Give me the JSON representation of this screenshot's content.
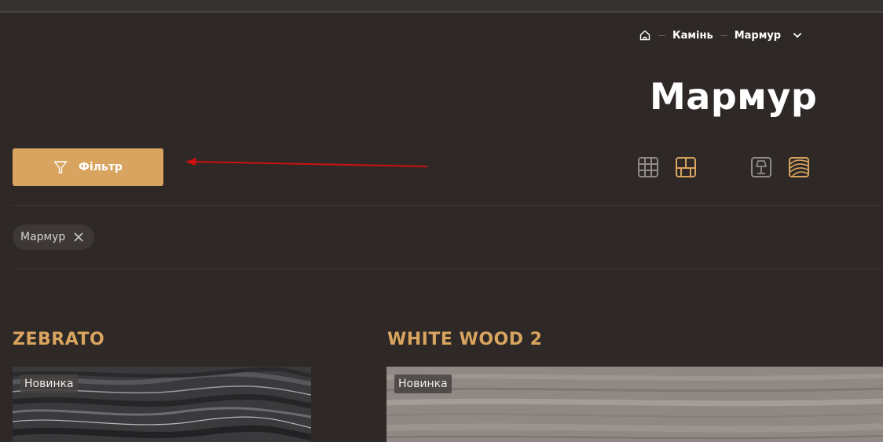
{
  "breadcrumb": {
    "items": [
      "Камінь",
      "Мармур"
    ]
  },
  "page": {
    "title": "Мармур"
  },
  "filter": {
    "button_label": "Фільтр"
  },
  "active_filters": [
    {
      "label": "Мармур"
    }
  ],
  "view_icons": [
    "grid-icon",
    "layout-icon",
    "lamp-icon",
    "wood-texture-icon"
  ],
  "products": [
    {
      "title": "ZEBRATO",
      "badge": "Новинка"
    },
    {
      "title": "WHITE WOOD 2",
      "badge": "Новинка"
    }
  ],
  "colors": {
    "background": "#2e2926",
    "accent": "#d9a45f",
    "annotation_arrow": "#cc1111"
  }
}
